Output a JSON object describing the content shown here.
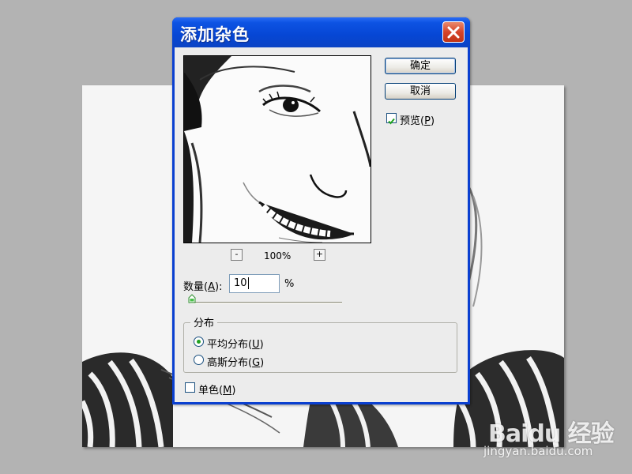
{
  "dialog": {
    "title": "添加杂色",
    "ok_label": "确定",
    "cancel_label": "取消",
    "preview_checkbox": {
      "label": "预览",
      "mnemonic": "P",
      "checked": true
    },
    "zoom": {
      "minus": "-",
      "plus": "+",
      "level": "100%"
    },
    "amount": {
      "label": "数量",
      "mnemonic": "A",
      "value": "10",
      "unit": "%",
      "slider_percent": 10
    },
    "distribution": {
      "title": "分布",
      "options": [
        {
          "label": "平均分布",
          "mnemonic": "U",
          "selected": true
        },
        {
          "label": "高斯分布",
          "mnemonic": "G",
          "selected": false
        }
      ]
    },
    "monochrome": {
      "label": "单色",
      "mnemonic": "M",
      "checked": false
    }
  },
  "watermark": {
    "logo": "Baidu 经验",
    "url": "jingyan.baidu.com"
  },
  "colors": {
    "titlebar": "#0646d4",
    "close": "#d5442a",
    "dialog_bg": "#ececec",
    "accent_check": "#21a121"
  }
}
